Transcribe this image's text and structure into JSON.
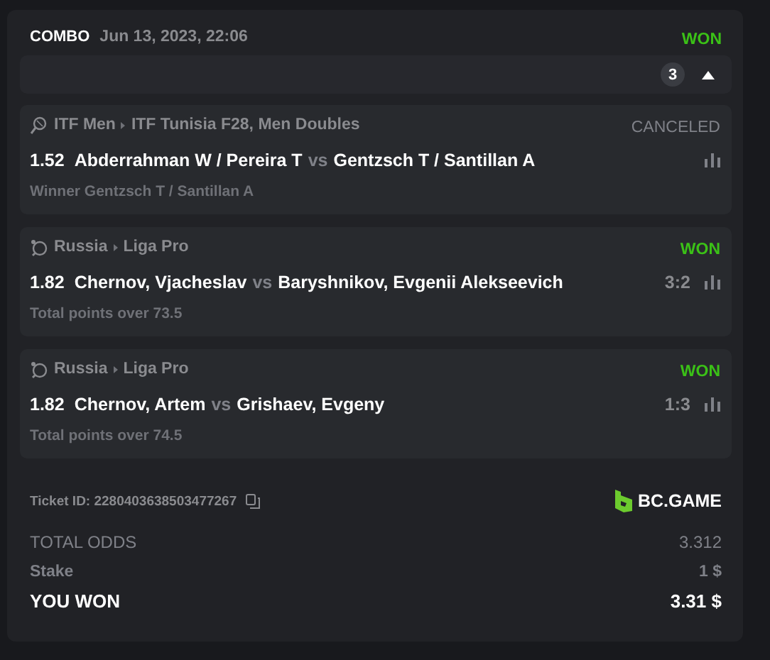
{
  "header": {
    "type": "COMBO",
    "date": "Jun 13, 2023, 22:06",
    "status": {
      "text": "WON",
      "kind": "won"
    }
  },
  "expander": {
    "count": "3",
    "expanded": true
  },
  "selections": [
    {
      "kind": "tennis",
      "category": "ITF Men",
      "tournament": "ITF Tunisia F28, Men Doubles",
      "status": {
        "text": "CANCELED",
        "kind": "canceled"
      },
      "odds": "1.52",
      "home": "Abderrahman W / Pereira T",
      "vs": "vs",
      "away": "Gentzsch T / Santillan A",
      "market": "Winner Gentzsch T / Santillan A"
    },
    {
      "kind": "table-tennis",
      "category": "Russia",
      "tournament": "Liga Pro",
      "status": {
        "text": "WON",
        "kind": "won"
      },
      "odds": "1.82",
      "home": "Chernov, Vjacheslav",
      "vs": "vs",
      "away": "Baryshnikov, Evgenii Alekseevich",
      "score": "3:2",
      "market": "Total points over 73.5"
    },
    {
      "kind": "table-tennis",
      "category": "Russia",
      "tournament": "Liga Pro",
      "status": {
        "text": "WON",
        "kind": "won"
      },
      "odds": "1.82",
      "home": "Chernov, Artem",
      "vs": "vs",
      "away": "Grishaev, Evgeny",
      "score": "1:3",
      "market": "Total points over 74.5"
    }
  ],
  "ticket": {
    "label": "Ticket ID: 2280403638503477267",
    "brand": "BC.GAME"
  },
  "summary": [
    {
      "label": "TOTAL ODDS",
      "value": "3.312",
      "kind": "plain"
    },
    {
      "label": "Stake",
      "value": "1 $",
      "kind": "bold"
    },
    {
      "label": "YOU WON",
      "value": "3.31 $",
      "kind": "total"
    }
  ]
}
